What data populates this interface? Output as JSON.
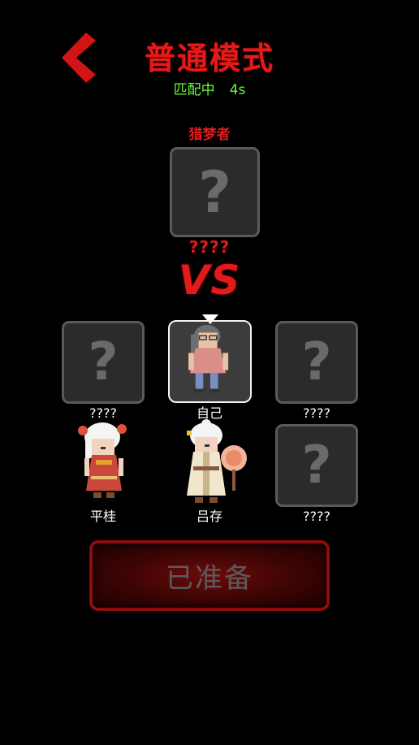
{
  "header": {
    "title": "普通模式",
    "status_label": "匹配中",
    "timer": "4s"
  },
  "hunter": {
    "role_label": "猎梦者",
    "slot_symbol": "?",
    "name": "????"
  },
  "vs_label": "VS",
  "players": [
    {
      "name": "????",
      "slot_symbol": "?"
    },
    {
      "name": "自己"
    },
    {
      "name": "????",
      "slot_symbol": "?"
    },
    {
      "name": "平桂"
    },
    {
      "name": "吕存"
    },
    {
      "name": "????",
      "slot_symbol": "?"
    }
  ],
  "ready_button": {
    "label": "已准备"
  },
  "colors": {
    "title_red": "#e31a1a",
    "status_green": "#66ff33",
    "slot_bg": "#2b2b2b",
    "slot_border": "#5a5a5a"
  },
  "icons": {
    "back": "chevron-left-icon",
    "self_marker": "triangle-down-icon"
  }
}
